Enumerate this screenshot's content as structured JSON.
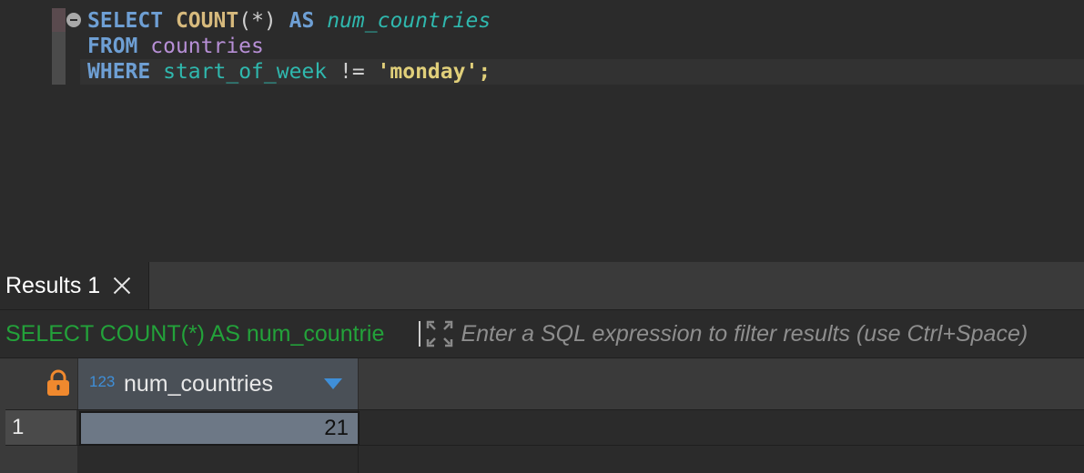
{
  "editor": {
    "line1": {
      "select": "SELECT",
      "count": "COUNT",
      "paren_open": "(",
      "star": "*",
      "paren_close": ")",
      "as": "AS",
      "alias": "num_countries"
    },
    "line2": {
      "from": "FROM",
      "table": "countries"
    },
    "line3": {
      "where": "WHERE",
      "column": "start_of_week",
      "operator": "!=",
      "value": "'monday'",
      "semicolon": ";"
    }
  },
  "results": {
    "tab_label": "Results 1",
    "query_preview": "SELECT COUNT(*) AS num_countrie",
    "filter_placeholder": "Enter a SQL expression to filter results (use Ctrl+Space)"
  },
  "grid": {
    "columns": [
      {
        "type_badge": "123",
        "name": "num_countries"
      }
    ],
    "rows": [
      {
        "row_number": "1",
        "values": [
          "21"
        ]
      }
    ]
  },
  "icons": {
    "fold": "fold-collapse-icon",
    "close": "close-icon",
    "expand": "expand-icon",
    "lock": "lock-icon",
    "sort": "sort-descending-icon"
  },
  "colors": {
    "keyword": "#6e9fd4",
    "function": "#d7ba7d",
    "identifier": "#2fb8ae",
    "table": "#b78fd6",
    "string": "#e0cf7a",
    "query_preview": "#23a23a",
    "lock": "#f0892e",
    "selected_cell": "#6d7886"
  }
}
